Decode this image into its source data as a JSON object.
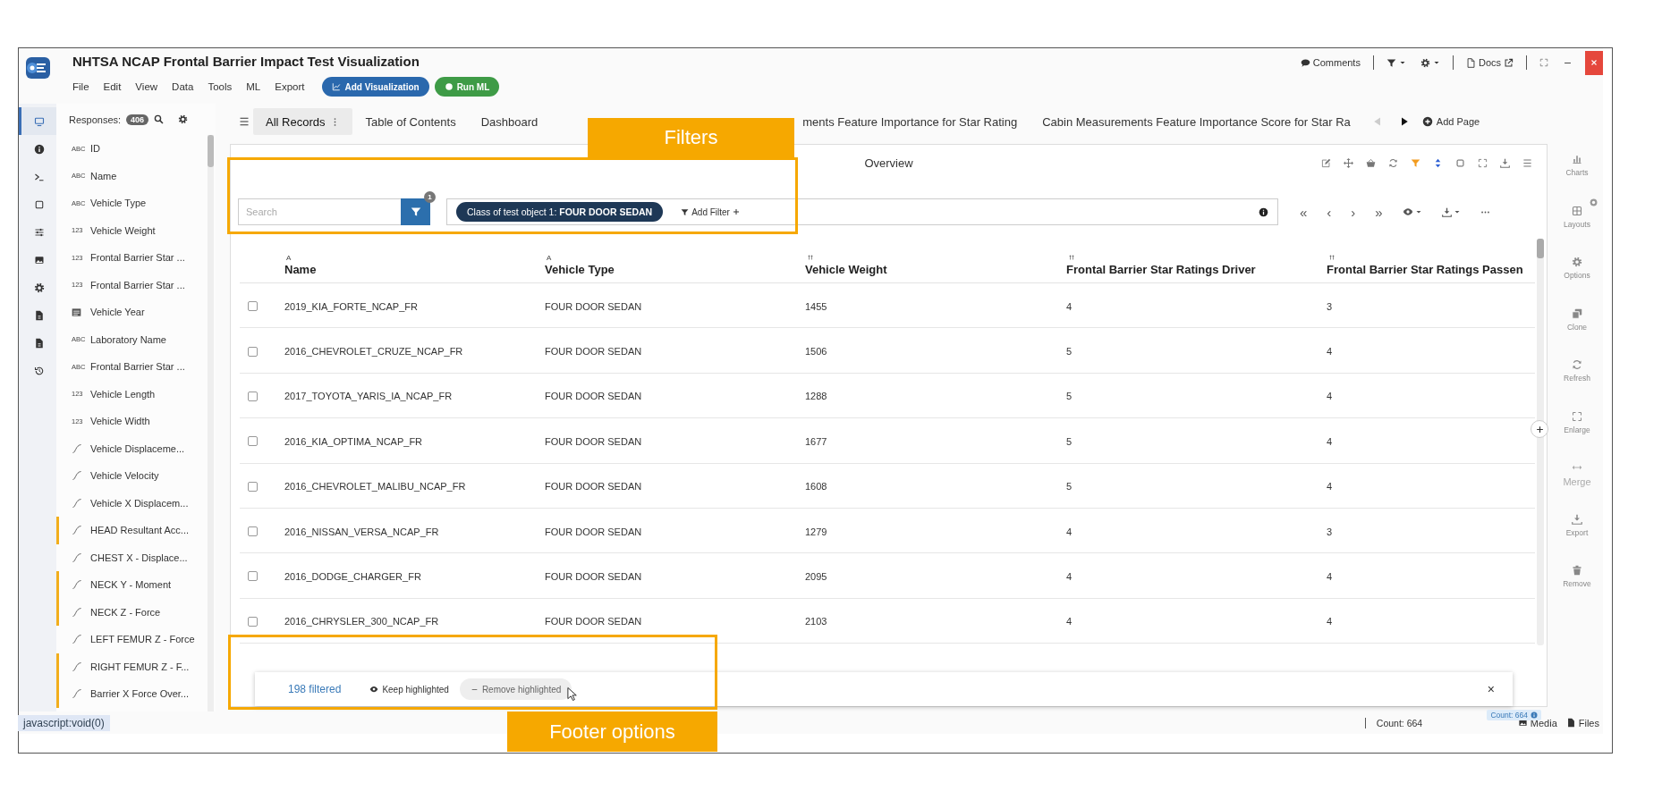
{
  "window": {
    "title": "NHTSA NCAP Frontal Barrier Impact Test Visualization"
  },
  "menu": [
    "File",
    "Edit",
    "View",
    "Data",
    "Tools",
    "ML",
    "Export"
  ],
  "toolbar_buttons": [
    {
      "kind": "visualization",
      "label": "Add Visualization"
    },
    {
      "kind": "ml",
      "label": "Run ML"
    }
  ],
  "header_actions": {
    "comments": "Comments",
    "docs": "Docs"
  },
  "rail": [
    {
      "selected": true
    },
    {
      "selected": false
    },
    {
      "selected": false
    },
    {
      "selected": false
    },
    {
      "selected": false
    },
    {
      "selected": false
    },
    {
      "selected": false
    },
    {
      "selected": false
    },
    {
      "selected": false
    },
    {
      "selected": false
    }
  ],
  "sidebar": {
    "title": "Responses:",
    "count": "406",
    "fields": [
      {
        "kind": "text",
        "tag": "ABC",
        "label": "ID",
        "highlighted": false
      },
      {
        "kind": "text",
        "tag": "ABC",
        "label": "Name",
        "highlighted": false
      },
      {
        "kind": "text",
        "tag": "ABC",
        "label": "Vehicle Type",
        "highlighted": false
      },
      {
        "kind": "number",
        "tag": "123",
        "label": "Vehicle Weight",
        "highlighted": false
      },
      {
        "kind": "number",
        "tag": "123",
        "label": "Frontal Barrier Star ...",
        "highlighted": false
      },
      {
        "kind": "number",
        "tag": "123",
        "label": "Frontal Barrier Star ...",
        "highlighted": false
      },
      {
        "kind": "date",
        "label": "Vehicle Year",
        "highlighted": false
      },
      {
        "kind": "text",
        "tag": "ABC",
        "label": "Laboratory Name",
        "highlighted": false
      },
      {
        "kind": "text",
        "tag": "ABC",
        "label": "Frontal Barrier Star ...",
        "highlighted": false
      },
      {
        "kind": "number",
        "tag": "123",
        "label": "Vehicle Length",
        "highlighted": false
      },
      {
        "kind": "number",
        "tag": "123",
        "label": "Vehicle Width",
        "highlighted": false
      },
      {
        "kind": "signal",
        "label": "Vehicle Displaceme...",
        "highlighted": false
      },
      {
        "kind": "signal",
        "label": "Vehicle Velocity",
        "highlighted": false
      },
      {
        "kind": "signal",
        "label": "Vehicle X Displacem...",
        "highlighted": false
      },
      {
        "kind": "signal",
        "label": "HEAD Resultant Acc...",
        "highlighted": true
      },
      {
        "kind": "signal",
        "label": "CHEST X - Displace...",
        "highlighted": false
      },
      {
        "kind": "signal",
        "label": "NECK Y - Moment",
        "highlighted": true
      },
      {
        "kind": "signal",
        "label": "NECK Z - Force",
        "highlighted": true
      },
      {
        "kind": "signal",
        "label": "LEFT FEMUR Z - Force",
        "highlighted": false
      },
      {
        "kind": "signal",
        "label": "RIGHT FEMUR Z - F...",
        "highlighted": true
      },
      {
        "kind": "signal",
        "label": "Barrier X Force Over...",
        "highlighted": true
      }
    ]
  },
  "tabs": [
    {
      "label": "All Records",
      "selected": true
    },
    {
      "label": "Table of Contents",
      "selected": false
    },
    {
      "label": "Dashboard",
      "selected": false
    },
    {
      "label": "ments Feature Importance for Star Rating",
      "selected": false
    },
    {
      "label": "Cabin Measurements Feature Importance Score for Star Ra",
      "selected": false
    }
  ],
  "add_page": "Add Page",
  "card": {
    "title": "Overview",
    "search": {
      "placeholder": "Search"
    },
    "filter_count": "1",
    "chip": "Class of test object 1: **FOUR DOOR SEDAN**",
    "add_filter": "Add Filter",
    "pager": [
      "«",
      "‹",
      "›",
      "»"
    ],
    "columns": [
      {
        "kind": "text",
        "mark": "A",
        "label": "Name"
      },
      {
        "kind": "text",
        "mark": "A",
        "label": "Vehicle Type"
      },
      {
        "kind": "number",
        "label": "Vehicle Weight"
      },
      {
        "kind": "number",
        "label": "Frontal Barrier Star Ratings Driver"
      },
      {
        "kind": "number",
        "label": "Frontal Barrier Star Ratings Passen"
      }
    ],
    "rows": [
      {
        "checked": false,
        "cells": [
          "2019_KIA_FORTE_NCAP_FR",
          "FOUR DOOR SEDAN",
          "1455",
          "4",
          "3"
        ]
      },
      {
        "checked": false,
        "cells": [
          "2016_CHEVROLET_CRUZE_NCAP_FR",
          "FOUR DOOR SEDAN",
          "1506",
          "5",
          "4"
        ]
      },
      {
        "checked": false,
        "cells": [
          "2017_TOYOTA_YARIS_IA_NCAP_FR",
          "FOUR DOOR SEDAN",
          "1288",
          "5",
          "4"
        ]
      },
      {
        "checked": false,
        "cells": [
          "2016_KIA_OPTIMA_NCAP_FR",
          "FOUR DOOR SEDAN",
          "1677",
          "5",
          "4"
        ]
      },
      {
        "checked": false,
        "cells": [
          "2016_CHEVROLET_MALIBU_NCAP_FR",
          "FOUR DOOR SEDAN",
          "1608",
          "5",
          "4"
        ]
      },
      {
        "checked": false,
        "cells": [
          "2016_NISSAN_VERSA_NCAP_FR",
          "FOUR DOOR SEDAN",
          "1279",
          "4",
          "3"
        ]
      },
      {
        "checked": false,
        "cells": [
          "2016_DODGE_CHARGER_FR",
          "FOUR DOOR SEDAN",
          "2095",
          "4",
          "4"
        ]
      },
      {
        "checked": false,
        "cells": [
          "2016_CHRYSLER_300_NCAP_FR",
          "FOUR DOOR SEDAN",
          "2103",
          "4",
          "4"
        ]
      }
    ],
    "footer": {
      "filtered": "198 filtered",
      "keep": "Keep highlighted",
      "remove": "Remove highlighted",
      "close": "×"
    },
    "count_badge": "Count: 664"
  },
  "side_panel": [
    {
      "label": "Charts",
      "disabled": false
    },
    {
      "label": "Layouts",
      "disabled": false
    },
    {
      "label": "Options",
      "disabled": false
    },
    {
      "label": "Clone",
      "disabled": false
    },
    {
      "label": "Refresh",
      "disabled": false
    },
    {
      "label": "Enlarge",
      "disabled": false
    },
    {
      "label": "Merge",
      "disabled": true
    },
    {
      "label": "Export",
      "disabled": false
    },
    {
      "label": "Remove",
      "disabled": false
    }
  ],
  "status_bar": {
    "link_hint": "javascript:void(0)",
    "count": "Count: 664",
    "media": "Media",
    "files": "Files"
  },
  "annotations": [
    {
      "label": "Filters"
    },
    {
      "label": "Footer options"
    }
  ]
}
